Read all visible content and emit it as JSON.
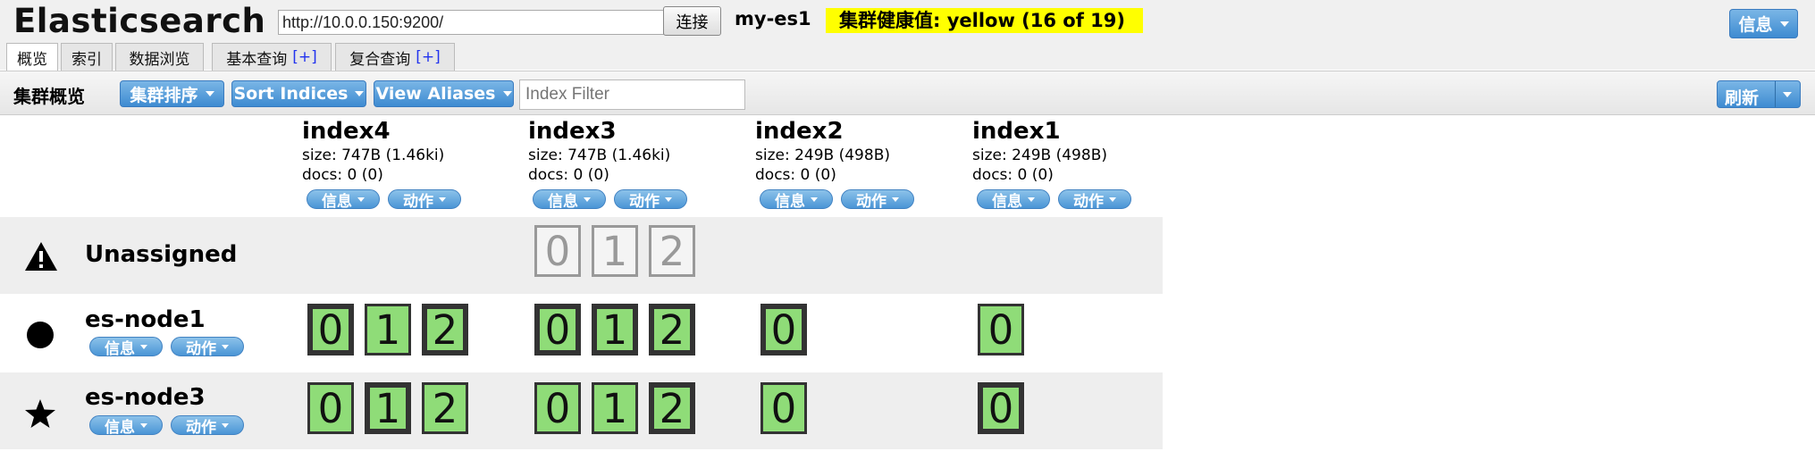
{
  "header": {
    "app_title": "Elasticsearch",
    "url_value": "http://10.0.0.150:9200/",
    "connect_label": "连接",
    "cluster_name": "my-es1",
    "health_text": "集群健康值: yellow (16 of 19)",
    "health_color": "#ffff00",
    "info_label": "信息"
  },
  "tabs": [
    {
      "label": "概览",
      "plus": ""
    },
    {
      "label": "索引",
      "plus": ""
    },
    {
      "label": "数据浏览",
      "plus": ""
    },
    {
      "label": "基本查询",
      "plus": "[+]"
    },
    {
      "label": "复合查询",
      "plus": "[+]"
    }
  ],
  "toolbar": {
    "title": "集群概览",
    "sort_cluster_label": "集群排序",
    "sort_indices_label": "Sort Indices",
    "view_aliases_label": "View Aliases",
    "filter_placeholder": "Index Filter",
    "refresh_label": "刷新"
  },
  "index_buttons": {
    "info": "信息",
    "action": "动作"
  },
  "indices": [
    {
      "name": "index4",
      "size": "size: 747B (1.46ki)",
      "docs": "docs: 0 (0)"
    },
    {
      "name": "index3",
      "size": "size: 747B (1.46ki)",
      "docs": "docs: 0 (0)"
    },
    {
      "name": "index2",
      "size": "size: 249B (498B)",
      "docs": "docs: 0 (0)"
    },
    {
      "name": "index1",
      "size": "size: 249B (498B)",
      "docs": "docs: 0 (0)"
    }
  ],
  "rows": [
    {
      "name": "Unassigned",
      "icon": "warning-icon"
    },
    {
      "name": "es-node1",
      "icon": "circle-icon"
    },
    {
      "name": "es-node3",
      "icon": "star-icon"
    }
  ],
  "shards": {
    "unassigned": {
      "index3": [
        "0",
        "1",
        "2"
      ]
    },
    "es-node1": {
      "index4": [
        "0",
        "1",
        "2"
      ],
      "index3": [
        "0",
        "1",
        "2"
      ],
      "index2": [
        "0"
      ],
      "index1": [
        "0"
      ]
    },
    "es-node3": {
      "index4": [
        "0",
        "1",
        "2"
      ],
      "index3": [
        "0",
        "1",
        "2"
      ],
      "index2": [
        "0"
      ],
      "index1": [
        "0"
      ]
    }
  },
  "colors": {
    "shard_assigned": "#8fdc78",
    "button_blue": "#4a95d6"
  }
}
